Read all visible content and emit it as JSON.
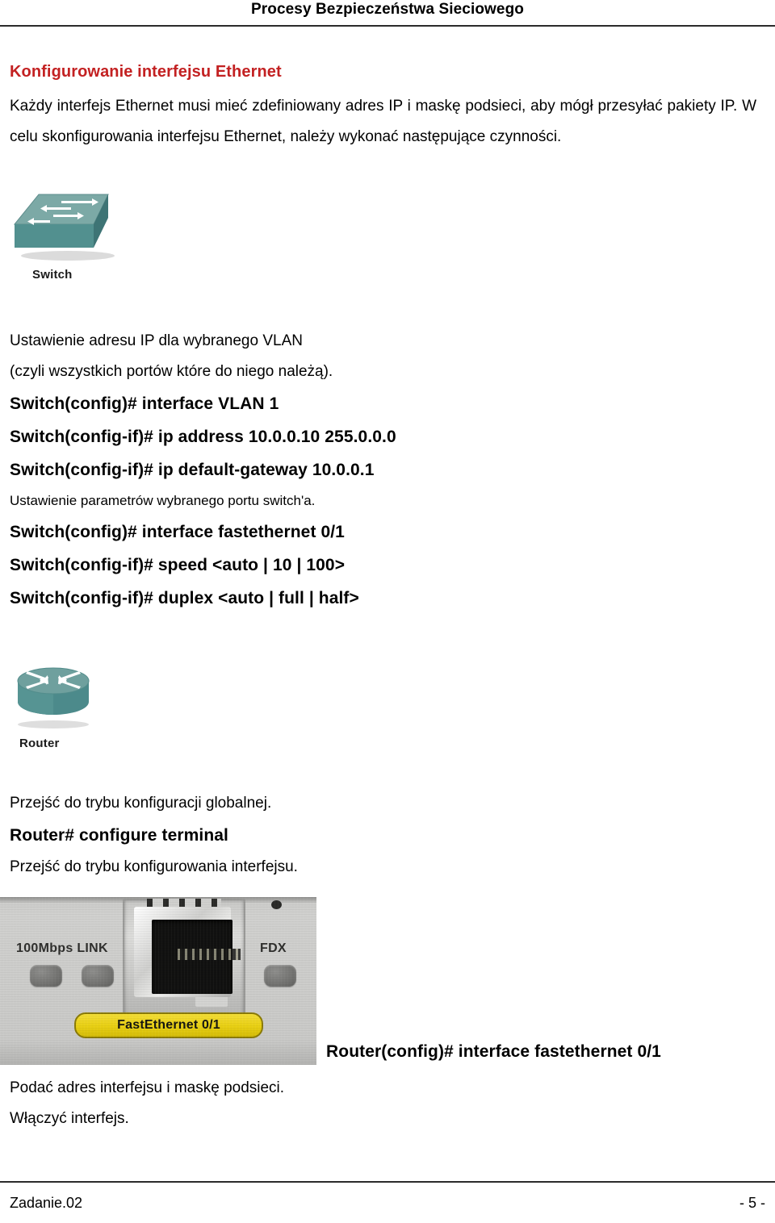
{
  "header": {
    "title": "Procesy Bezpieczeństwa Sieciowego"
  },
  "section": {
    "heading": "Konfigurowanie interfejsu Ethernet",
    "heading_color": "#C32122",
    "intro": "Każdy interfejs Ethernet musi mieć zdefiniowany adres IP i maskę podsieci, aby mógł przesyłać pakiety IP. W celu skonfigurowania interfejsu Ethernet, należy wykonać następujące czynności."
  },
  "switch_figure": {
    "icon_name": "cisco-switch-icon",
    "caption": "Switch",
    "body_color": "#5C9798",
    "top_color": "#79A8A6",
    "side_color": "#417375"
  },
  "switch_block": {
    "desc_line_1": "Ustawienie adresu IP dla wybranego VLAN",
    "desc_line_2": "(czyli wszystkich portów które do niego należą).",
    "cmd_1": "Switch(config)# interface VLAN 1",
    "cmd_2": "Switch(config-if)# ip address 10.0.0.10 255.0.0.0",
    "cmd_3": "Switch(config-if)# ip default-gateway 10.0.0.1",
    "desc_line_3": "Ustawienie parametrów wybranego portu switch'a.",
    "cmd_4": "Switch(config)# interface fastethernet 0/1",
    "cmd_5": "Switch(config-if)# speed <auto | 10 | 100>",
    "cmd_6": "Switch(config-if)# duplex <auto | full | half>"
  },
  "router_figure": {
    "icon_name": "cisco-router-icon",
    "caption": "Router",
    "body_color": "#5C9798",
    "top_color": "#6E9F9E"
  },
  "router_block": {
    "desc_line_1": "Przejść do trybu konfiguracji globalnej.",
    "cmd_1": "Router# configure terminal",
    "desc_line_2": "Przejść do trybu konfigurowania interfejsu.",
    "cmd_2": "Router(config)# interface fastethernet 0/1",
    "desc_line_3": "Podać adres interfejsu i maskę podsieci.",
    "desc_line_4": "Włączyć interfejs."
  },
  "rj45_photo": {
    "label_link": "100Mbps LINK",
    "label_fdx": "FDX",
    "port_badge": "FastEthernet 0/1",
    "badge_color": "#E8CF12"
  },
  "footer": {
    "left": "Zadanie.02",
    "right": "- 5 -"
  }
}
